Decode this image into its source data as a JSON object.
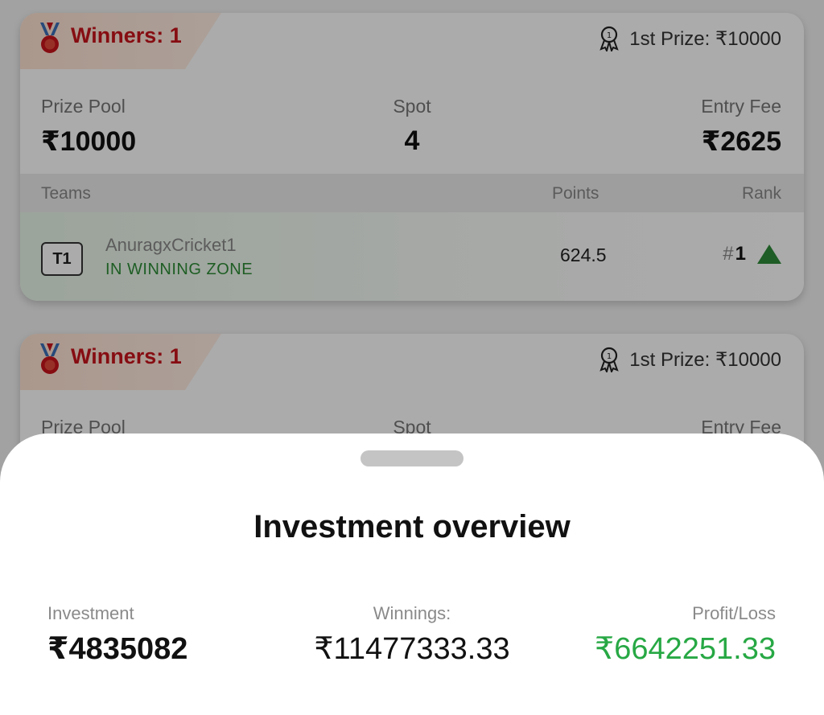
{
  "contests": [
    {
      "winners_label": "Winners: 1",
      "first_prize": "1st Prize: ₹10000",
      "prize_pool_label": "Prize Pool",
      "prize_pool_value": "₹10000",
      "spot_label": "Spot",
      "spot_value": "4",
      "entry_fee_label": "Entry Fee",
      "entry_fee_value": "₹2625",
      "table": {
        "headers": [
          "Teams",
          "Points",
          "Rank"
        ],
        "rows": [
          {
            "badge": "T1",
            "team_name": "AnuragxCricket1",
            "status": "IN WINNING ZONE",
            "points": "624.5",
            "rank_hash": "#",
            "rank_num": "1"
          }
        ]
      }
    },
    {
      "winners_label": "Winners: 1",
      "first_prize": "1st Prize: ₹10000",
      "prize_pool_label": "Prize Pool",
      "spot_label": "Spot",
      "entry_fee_label": "Entry Fee"
    }
  ],
  "sheet": {
    "title": "Investment overview",
    "investment_label": "Investment",
    "investment_value": "₹4835082",
    "winnings_label": "Winnings:",
    "winnings_value": "₹11477333.33",
    "profit_label": "Profit/Loss",
    "profit_value": "₹6642251.33"
  },
  "colors": {
    "winners_red": "#c8141b",
    "winning_zone_green": "#2d8c37",
    "profit_green": "#27a844",
    "rank_arrow_green": "#2e8b3a"
  },
  "icons": [
    "medal-icon",
    "ribbon-award-icon",
    "rank-up-arrow-icon"
  ]
}
